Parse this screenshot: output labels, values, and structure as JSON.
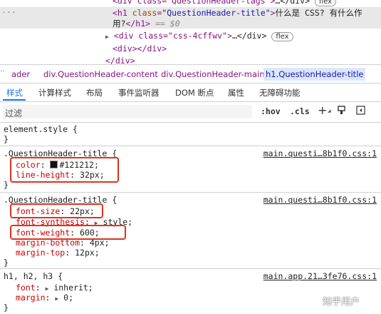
{
  "dom": {
    "line_top": {
      "open": "<div class=\"QuestionHeader-tags\">",
      "close": "…</div>",
      "badge": "flex"
    },
    "selected": {
      "marker": "···",
      "tag_open": "<h1",
      "attr": "class",
      "attr_val": "\"QuestionHeader-title\"",
      "gt": ">",
      "text1": "什么是 CSS? 有什么作",
      "text2": "用?",
      "close": "</h1>",
      "eq": "== $0"
    },
    "line3": {
      "tag": "<div class=\"css-4cffwv\">",
      "rest": "…</div>",
      "badge": "flex"
    },
    "line4": "<div></div>",
    "line5": "</div>"
  },
  "breadcrumb": {
    "items": [
      "ader",
      "div.QuestionHeader-content",
      "div.QuestionHeader-main",
      "h1.QuestionHeader-title"
    ]
  },
  "tabs": [
    "样式",
    "计算样式",
    "布局",
    "事件监听器",
    "DOM 断点",
    "属性",
    "无障碍功能"
  ],
  "filter": {
    "placeholder": "过滤",
    "hov": ":hov",
    "cls": ".cls",
    "plus": "+"
  },
  "rules": {
    "element_style": {
      "selector": "element.style {",
      "close": "}"
    },
    "r1": {
      "selector": ".QuestionHeader-title {",
      "source": "main.questi…8b1f0.css:1",
      "props": [
        {
          "name": "color",
          "value": "#121212;"
        },
        {
          "name": "line-height",
          "value": "32px;"
        }
      ],
      "close": "}"
    },
    "r2": {
      "selector": ".QuestionHeader-title {",
      "source": "main.questi…8b1f0.css:1",
      "props": [
        {
          "name": "font-size",
          "value": "22px;"
        },
        {
          "name": "font-synthesis",
          "value": "style;"
        },
        {
          "name": "font-weight",
          "value": "600;"
        },
        {
          "name": "margin-bottom",
          "value": "4px;"
        },
        {
          "name": "margin-top",
          "value": "12px;"
        }
      ],
      "close": "}"
    },
    "r3": {
      "selector": "h1, h2, h3 {",
      "source": "main.app.21…3fe76.css:1",
      "props": [
        {
          "name": "font",
          "value": "inherit;"
        },
        {
          "name": "margin",
          "value": "0;"
        }
      ],
      "close": "}"
    }
  },
  "watermark": "知乎用户",
  "colors": {
    "accent": "#1a73e8",
    "highlight_box": "#e0331b",
    "swatch": "#121212"
  }
}
